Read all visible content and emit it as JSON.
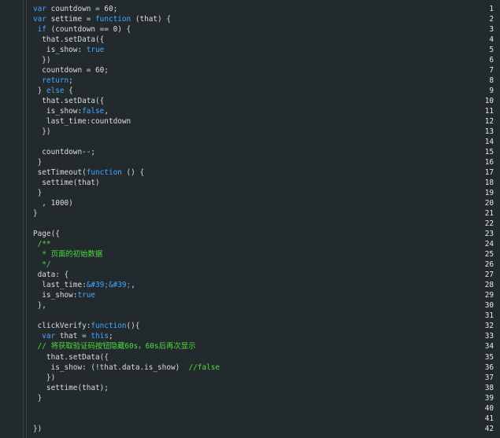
{
  "lines": [
    [
      [
        "kw",
        "var"
      ],
      [
        "pl",
        " countdown = 60;"
      ]
    ],
    [
      [
        "kw",
        "var"
      ],
      [
        "pl",
        " settime = "
      ],
      [
        "kw",
        "function"
      ],
      [
        "pl",
        " (that) {"
      ]
    ],
    [
      [
        "pl",
        " "
      ],
      [
        "kw",
        "if"
      ],
      [
        "pl",
        " (countdown == 0) {"
      ]
    ],
    [
      [
        "pl",
        "  that.setData({"
      ]
    ],
    [
      [
        "pl",
        "   is_show: "
      ],
      [
        "kw",
        "true"
      ]
    ],
    [
      [
        "pl",
        "  })"
      ]
    ],
    [
      [
        "pl",
        "  countdown = 60;"
      ]
    ],
    [
      [
        "pl",
        "  "
      ],
      [
        "kw",
        "return"
      ],
      [
        "pl",
        ";"
      ]
    ],
    [
      [
        "pl",
        " } "
      ],
      [
        "kw",
        "else"
      ],
      [
        "pl",
        " {"
      ]
    ],
    [
      [
        "pl",
        "  that.setData({"
      ]
    ],
    [
      [
        "pl",
        "   is_show:"
      ],
      [
        "kw",
        "false"
      ],
      [
        "pl",
        ","
      ]
    ],
    [
      [
        "pl",
        "   last_time:countdown"
      ]
    ],
    [
      [
        "pl",
        "  })"
      ]
    ],
    [],
    [
      [
        "pl",
        "  countdown--;"
      ]
    ],
    [
      [
        "pl",
        " }"
      ]
    ],
    [
      [
        "pl",
        " setTimeout("
      ],
      [
        "kw",
        "function"
      ],
      [
        "pl",
        " () {"
      ]
    ],
    [
      [
        "pl",
        "  settime(that)"
      ]
    ],
    [
      [
        "pl",
        " }"
      ]
    ],
    [
      [
        "pl",
        "  , 1000)"
      ]
    ],
    [
      [
        "pl",
        "}"
      ]
    ],
    [],
    [
      [
        "pl",
        "Page({"
      ]
    ],
    [
      [
        "cm",
        " /**"
      ]
    ],
    [
      [
        "cm",
        "  * 页面的初始数据"
      ]
    ],
    [
      [
        "cm",
        "  */"
      ]
    ],
    [
      [
        "pl",
        " data: {"
      ]
    ],
    [
      [
        "pl",
        "  last_time:"
      ],
      [
        "kw",
        "&#39;&#39;"
      ],
      [
        "pl",
        ","
      ]
    ],
    [
      [
        "pl",
        "  is_show:"
      ],
      [
        "kw",
        "true"
      ]
    ],
    [
      [
        "pl",
        " },"
      ]
    ],
    [],
    [
      [
        "pl",
        " clickVerify:"
      ],
      [
        "kw",
        "function"
      ],
      [
        "pl",
        "(){"
      ]
    ],
    [
      [
        "pl",
        "  "
      ],
      [
        "kw",
        "var"
      ],
      [
        "pl",
        " that = "
      ],
      [
        "kw",
        "this"
      ],
      [
        "pl",
        ";"
      ]
    ],
    [
      [
        "cm",
        " // 将获取验证码按钮隐藏60s，60s后再次显示"
      ]
    ],
    [
      [
        "pl",
        "   that.setData({"
      ]
    ],
    [
      [
        "pl",
        "    is_show: (!that.data.is_show)  "
      ],
      [
        "cm",
        "//false"
      ]
    ],
    [
      [
        "pl",
        "   })"
      ]
    ],
    [
      [
        "pl",
        "   settime(that);"
      ]
    ],
    [
      [
        "pl",
        " }"
      ]
    ],
    [],
    [],
    [
      [
        "pl",
        "})"
      ]
    ]
  ],
  "line_numbers": [
    "1",
    "2",
    "3",
    "4",
    "5",
    "6",
    "7",
    "8",
    "9",
    "10",
    "11",
    "12",
    "13",
    "14",
    "15",
    "16",
    "17",
    "18",
    "19",
    "20",
    "21",
    "22",
    "23",
    "24",
    "25",
    "26",
    "27",
    "28",
    "29",
    "30",
    "31",
    "32",
    "33",
    "34",
    "35",
    "36",
    "37",
    "38",
    "39",
    "40",
    "41",
    "42"
  ],
  "colors": {
    "keyword": "#45a5ff",
    "comment": "#4ddc3a",
    "text": "#dcdcdc",
    "background": "#232a2e"
  }
}
